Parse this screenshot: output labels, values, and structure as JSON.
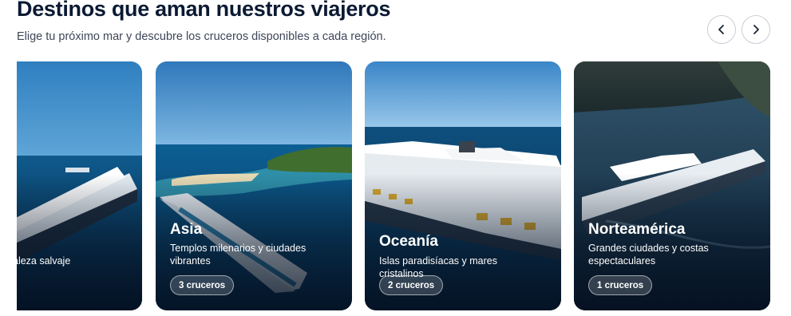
{
  "header": {
    "title": "Destinos que aman nuestros viajeros",
    "subtitle": "Elige tu próximo mar y descubre los cruceros disponibles a cada región."
  },
  "nav": {
    "prev_icon": "chevron-left-icon",
    "next_icon": "chevron-right-icon"
  },
  "cards": [
    {
      "name": "",
      "description": "rdos y naturaleza salvaje",
      "count": ""
    },
    {
      "name": "Asia",
      "description": "Templos milenarios y ciudades vibrantes",
      "count": "3 cruceros"
    },
    {
      "name": "Oceanía",
      "description": "Islas paradisíacas y mares cristalinos",
      "count": "2 cruceros"
    },
    {
      "name": "Norteamérica",
      "description": "Grandes ciudades y costas espectaculares",
      "count": "1 cruceros"
    }
  ],
  "colors": {
    "title": "#0b1a33",
    "sea": "#0c4a78",
    "sky": "#4a8ec4"
  }
}
